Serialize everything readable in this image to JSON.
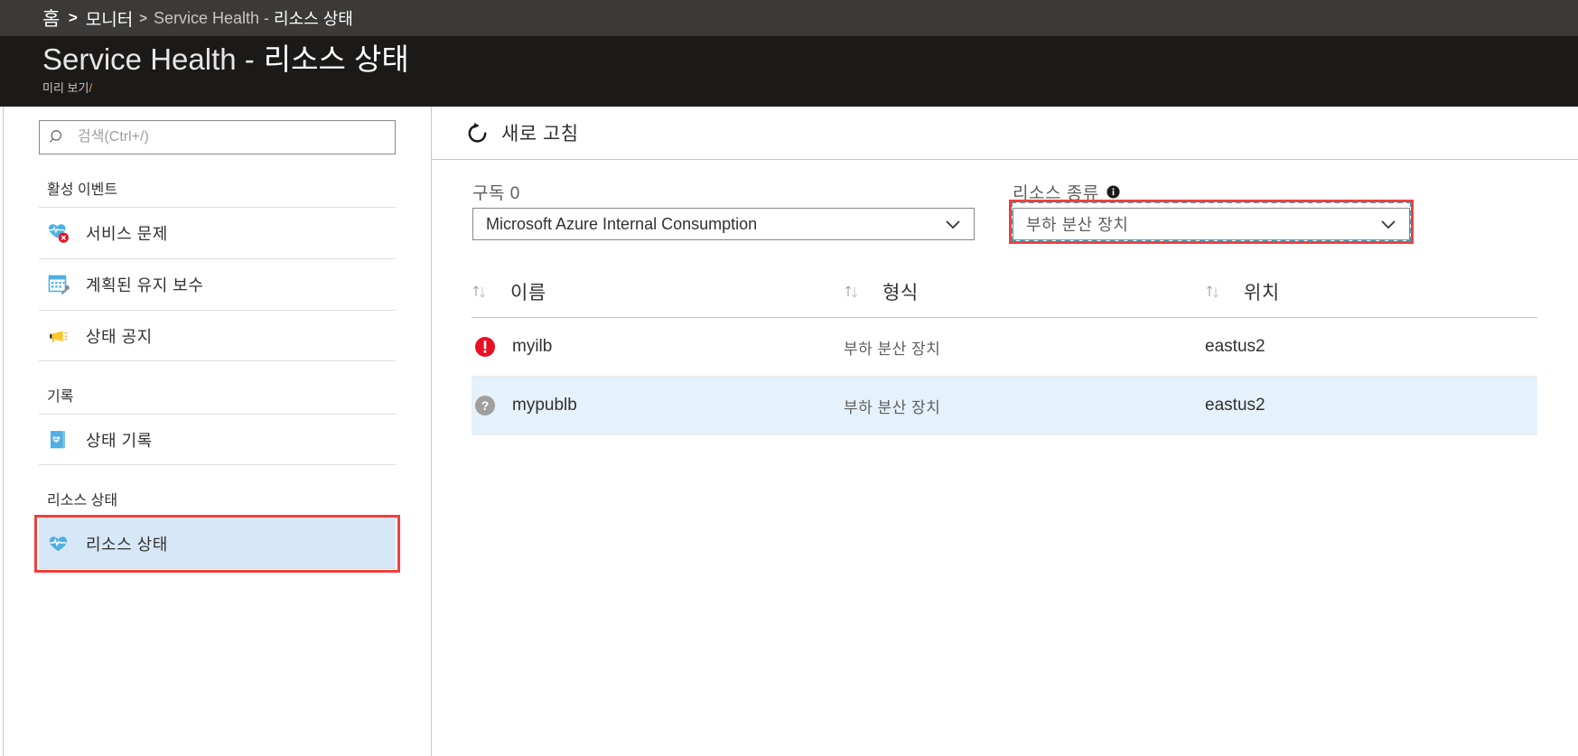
{
  "breadcrumb": {
    "home": "홈",
    "separator": ">",
    "monitor": "모니터",
    "separator2": ">",
    "current_en": "Service Health -",
    "current_kor": "리소스 상태"
  },
  "header": {
    "title_en": "Service Health -",
    "title_kor": "리소스 상태",
    "subtitle": "미리 보기",
    "subtitle_slash": "/"
  },
  "sidebar": {
    "search": {
      "placeholder": "검색(Ctrl+/)",
      "value": "",
      "icon": "search-icon"
    },
    "sections": [
      {
        "label": "활성 이벤트",
        "items": [
          {
            "label": "서비스 문제",
            "icon": "service-issues-icon"
          },
          {
            "label": "계획된 유지 보수",
            "icon": "planned-maintenance-icon"
          },
          {
            "label": "상태 공지",
            "icon": "health-advisories-icon"
          }
        ]
      },
      {
        "label": "기록",
        "items": [
          {
            "label": "상태 기록",
            "icon": "health-history-icon"
          }
        ]
      },
      {
        "label": "리소스 상태",
        "items": [
          {
            "label": "리소스 상태",
            "icon": "resource-health-icon",
            "selected": true
          }
        ]
      }
    ]
  },
  "toolbar": {
    "refresh_label": "새로 고침",
    "refresh_icon": "refresh-icon"
  },
  "filters": {
    "subscription": {
      "label": "구독 0",
      "value": "Microsoft Azure Internal Consumption",
      "chevron": "chevron-down-icon"
    },
    "resource_type": {
      "label": "리소스 종류",
      "info_icon": "info-icon",
      "value": "부하 분산 장치",
      "chevron": "chevron-down-icon"
    }
  },
  "table": {
    "columns": [
      {
        "label": "이름",
        "sort_icon": "sort-icon"
      },
      {
        "label": "형식",
        "sort_icon": "sort-icon"
      },
      {
        "label": "위치",
        "sort_icon": "sort-icon"
      }
    ],
    "rows": [
      {
        "status_icon": "error-icon",
        "name": "myilb",
        "type": "부하 분산 장치",
        "location": "eastus2",
        "highlight": false
      },
      {
        "status_icon": "unknown-icon",
        "name": "mypublb",
        "type": "부하 분산 장치",
        "location": "eastus2",
        "highlight": true
      }
    ]
  },
  "colors": {
    "chrome_dark": "#1b1a19",
    "breadcrumb_bar": "#3b3a39",
    "annotation_red": "#f0403c",
    "focus_blue": "#3ba3d0",
    "selected_row": "#e5f1fb",
    "selected_nav": "#d6e8f8",
    "status_error_red": "#e81123",
    "status_unknown_gray": "#a19f9d",
    "azure_blue": "#50b0e3"
  }
}
